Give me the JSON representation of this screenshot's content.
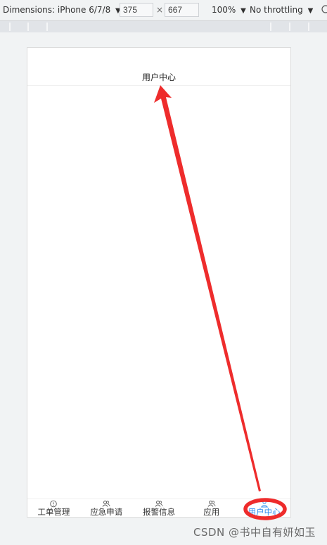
{
  "devtools": {
    "dimensions_label": "Dimensions: iPhone 6/7/8",
    "width_value": "375",
    "times": "×",
    "height_value": "667",
    "zoom": "100%",
    "throttling": "No throttling"
  },
  "app": {
    "nav_title": "用户中心",
    "tabs": [
      {
        "label": "工单管理",
        "icon": "info-circle-icon"
      },
      {
        "label": "应急申请",
        "icon": "users-icon"
      },
      {
        "label": "报警信息",
        "icon": "users-icon"
      },
      {
        "label": "应用",
        "icon": "users-icon"
      },
      {
        "label": "用户中心",
        "icon": "user-icon",
        "active": true
      }
    ],
    "active_color": "#2d8cf0"
  },
  "annotation": {
    "arrow_color": "#ee2c2c"
  },
  "watermark": "CSDN @书中自有妍如玉"
}
